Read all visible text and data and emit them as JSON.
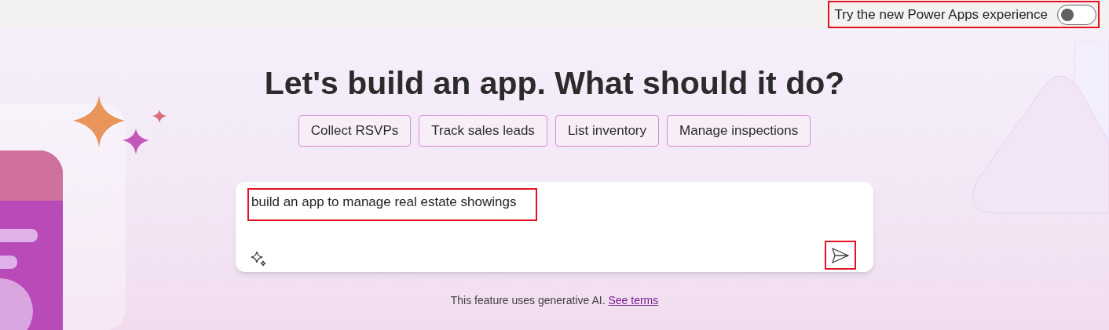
{
  "header": {
    "toggle_label": "Try the new Power Apps experience",
    "toggle_on": false
  },
  "heading": "Let's build an app. What should it do?",
  "suggestions": [
    "Collect RSVPs",
    "Track sales leads",
    "List inventory",
    "Manage inspections"
  ],
  "prompt": {
    "value": "build an app to manage real estate showings"
  },
  "disclaimer": {
    "text": "This feature uses generative AI.",
    "link": "See terms"
  }
}
